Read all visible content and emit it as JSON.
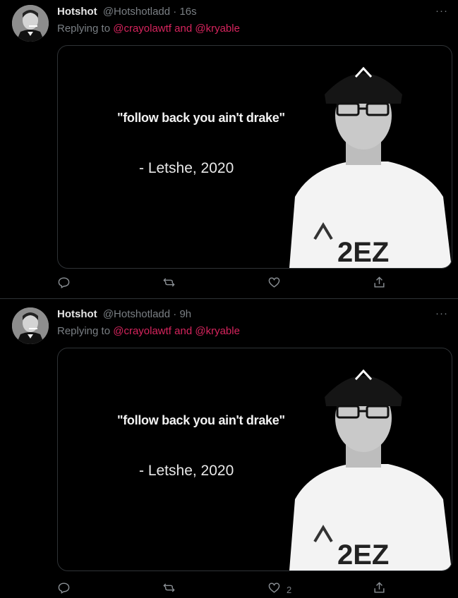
{
  "tweets": [
    {
      "name": "Hotshot",
      "handle": "@Hotshotladd",
      "separator": "·",
      "time": "16s",
      "replying_prefix": "Replying to",
      "mention_1": "@crayolawtf",
      "conjunction": "and",
      "mention_2": "@kryable",
      "more": "···",
      "media": {
        "quote": "\"follow back you ain't drake\"",
        "attribution": "- Letshe, 2020",
        "shirt_text": "2EZ"
      },
      "actions": {
        "reply_count": "",
        "retweet_count": "",
        "like_count": ""
      }
    },
    {
      "name": "Hotshot",
      "handle": "@Hotshotladd",
      "separator": "·",
      "time": "9h",
      "replying_prefix": "Replying to",
      "mention_1": "@crayolawtf",
      "conjunction": "and",
      "mention_2": "@kryable",
      "more": "···",
      "media": {
        "quote": "\"follow back you ain't drake\"",
        "attribution": "- Letshe, 2020",
        "shirt_text": "2EZ"
      },
      "actions": {
        "reply_count": "",
        "retweet_count": "",
        "like_count": "2"
      }
    }
  ],
  "icons": [
    "reply-icon",
    "retweet-icon",
    "like-icon",
    "share-icon",
    "more-icon"
  ],
  "colors": {
    "background": "#000000",
    "mention": "#d6245d",
    "muted": "#7a7f84",
    "border": "#2f3336"
  }
}
